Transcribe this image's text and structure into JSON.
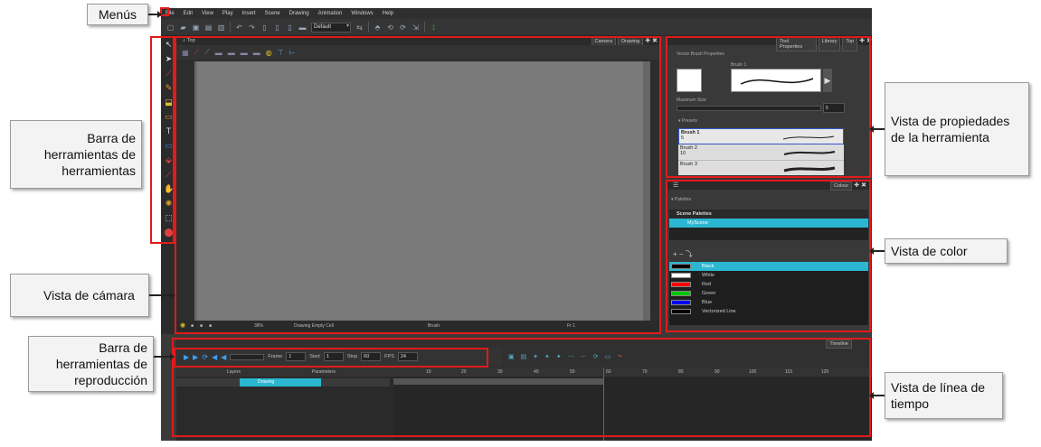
{
  "menus": [
    "File",
    "Edit",
    "View",
    "Play",
    "Insert",
    "Scene",
    "Drawing",
    "Animation",
    "Windows",
    "Help"
  ],
  "toolbar": {
    "workspace": "Default"
  },
  "camera": {
    "top_label": "Top",
    "tabs": [
      "Camera",
      "Drawing"
    ],
    "zoom": "38%",
    "status_cell": "Drawing Empty Cell",
    "status_tool": "Brush",
    "status_frame": "Fr 1"
  },
  "tool_properties": {
    "tabs": [
      "Tool Properties",
      "Library",
      "Top"
    ],
    "title": "Vector Brush Properties",
    "brush_name": "Brush 1",
    "max_size_label": "Maximum Size",
    "max_size_value": "5",
    "presets_label": "Presets",
    "presets": [
      {
        "name": "Brush 1",
        "size": "5"
      },
      {
        "name": "Brush 2",
        "size": "10"
      },
      {
        "name": "Brush 3",
        "size": ""
      }
    ]
  },
  "colour": {
    "tab": "Colour",
    "palettes_label": "Palettes",
    "scene_palettes": "Scene Palettes",
    "palette": "MyScene",
    "swatches": [
      {
        "name": "Black",
        "color": "#000000"
      },
      {
        "name": "White",
        "color": "#ffffff"
      },
      {
        "name": "Red",
        "color": "#ff0000"
      },
      {
        "name": "Green",
        "color": "#00c800"
      },
      {
        "name": "Blue",
        "color": "#0000ff"
      },
      {
        "name": "Vectorized Line",
        "color": "#000000"
      }
    ]
  },
  "playback": {
    "frame_label": "Frame",
    "frame_value": "1",
    "start_label": "Start",
    "start_value": "1",
    "stop_label": "Stop",
    "stop_value": "60",
    "fps_label": "FPS",
    "fps_value": "24"
  },
  "timeline": {
    "tab": "Timeline",
    "layers_header": "Layers",
    "parameters_header": "Parameters",
    "layer_name": "Drawing",
    "ruler": [
      "10",
      "20",
      "30",
      "40",
      "50",
      "60",
      "70",
      "80",
      "90",
      "100",
      "110",
      "120"
    ]
  },
  "annotations": {
    "menus": "Menús",
    "tools": "Barra de herramientas de herramientas",
    "camera": "Vista de cámara",
    "playback": "Barra de herramientas de reproducción",
    "tool_props": "Vista de propiedades de la herramienta",
    "color": "Vista de color",
    "timeline": "Vista de línea de tiempo"
  },
  "accent": "#2bb7d1",
  "highlight": "#e01b1b"
}
